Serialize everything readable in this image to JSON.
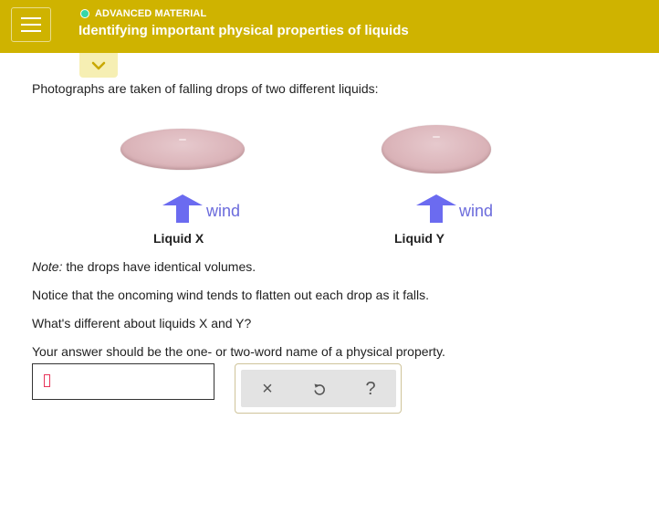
{
  "header": {
    "badge": "ADVANCED MATERIAL",
    "title": "Identifying important physical properties of liquids"
  },
  "question": {
    "intro": "Photographs are taken of falling drops of two different liquids:",
    "liquids": [
      {
        "label": "Liquid X",
        "wind_label": "wind"
      },
      {
        "label": "Liquid Y",
        "wind_label": "wind"
      }
    ],
    "note_prefix": "Note:",
    "note_text": " the drops have identical volumes.",
    "line2": "Notice that the oncoming wind tends to flatten out each drop as it falls.",
    "line3": "What's different about liquids X and Y?",
    "line4": "Your answer should be the one- or two-word name of a physical property."
  },
  "answer": {
    "value": ""
  },
  "tools": {
    "clear_symbol": "×",
    "undo_icon": "undo-icon",
    "help_symbol": "?"
  },
  "colors": {
    "header_bg": "#cfb300",
    "badge_dot": "#36d6a8",
    "wind_arrow": "#6b6bf0",
    "drop": "#dcb6bb",
    "cursor": "#e8355a"
  }
}
